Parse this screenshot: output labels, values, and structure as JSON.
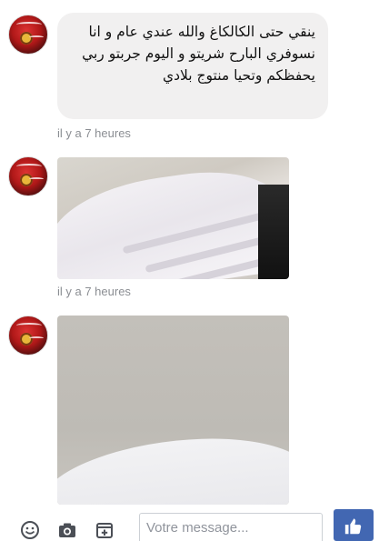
{
  "messages": [
    {
      "type": "text",
      "text": "ينقي حتى الكالكاغ والله عندي عام و انا نسوفري البارح شريتو و اليوم جربتو ربي يحفظكم وتحيا منتوج بلادي",
      "timestamp": "il y a 7 heures"
    },
    {
      "type": "image",
      "image_icon": "photo-sink-tray-closeup",
      "timestamp": "il y a 7 heures"
    },
    {
      "type": "image",
      "image_icon": "photo-sink-tray-wide"
    }
  ],
  "composer": {
    "placeholder": "Votre message...",
    "icons": [
      "emoji-icon",
      "camera-icon",
      "sticker-icon",
      "like-icon"
    ]
  },
  "colors": {
    "bubble": "#f1f0f0",
    "timestamp": "#8b8e93",
    "like_button": "#4267b2",
    "composer_icon": "#4b4f56"
  }
}
